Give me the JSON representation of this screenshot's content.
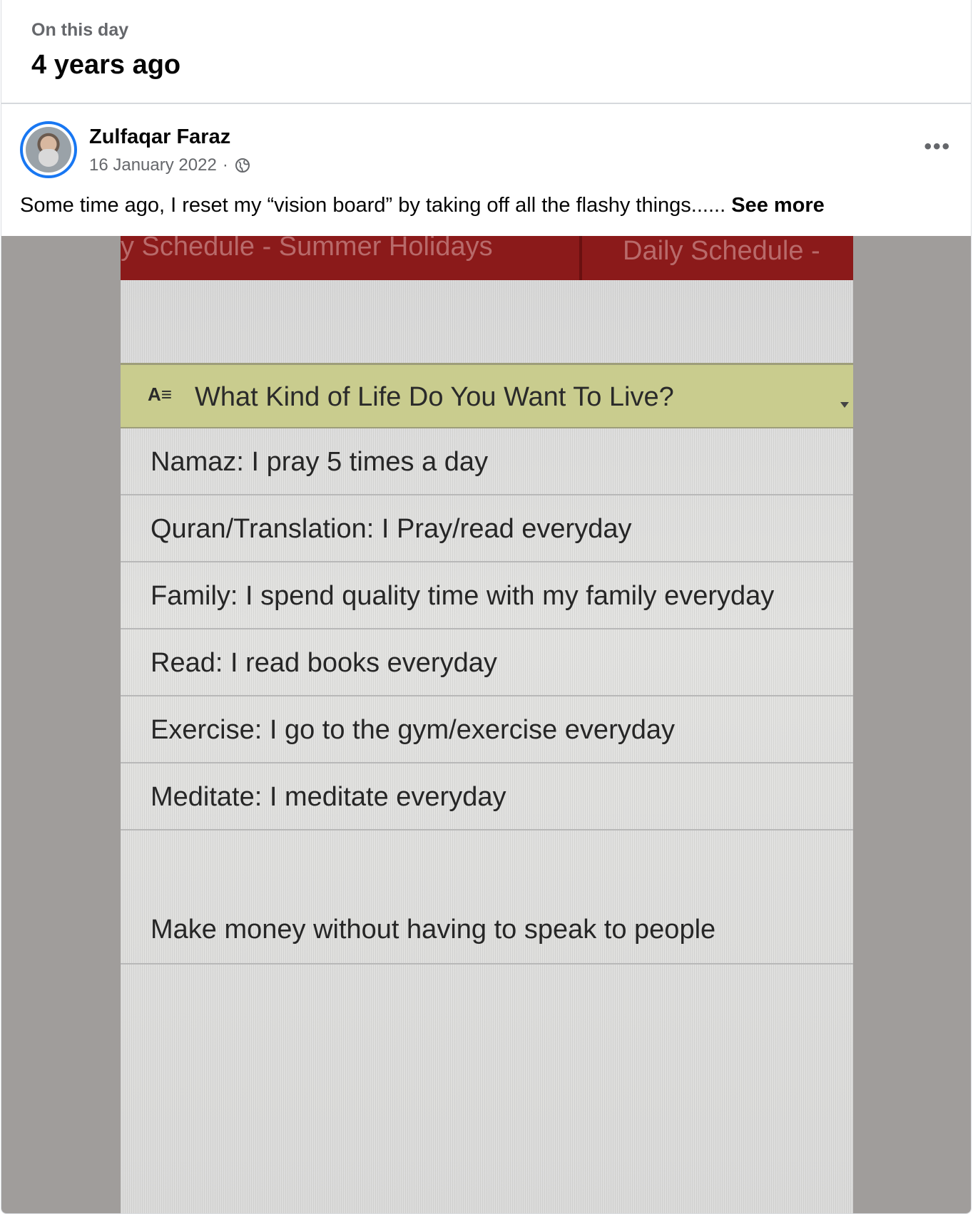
{
  "memory": {
    "kicker": "On this day",
    "title": "4 years ago"
  },
  "post": {
    "author": "Zulfaqar Faraz",
    "date": "16 January 2022",
    "separator": "·",
    "privacy_icon": "globe-icon",
    "more_icon": "more-options-icon",
    "text": "Some time ago, I reset my “vision board” by taking off all the flashy things......",
    "see_more": "See more"
  },
  "photo": {
    "tabs": [
      "y Schedule - Summer Holidays",
      "Daily Schedule -"
    ],
    "heading_icon": "A≡",
    "heading": "What Kind of Life Do You Want To Live?",
    "rows": [
      "Namaz: I pray 5 times a day",
      "Quran/Translation: I Pray/read everyday",
      "Family: I spend quality time with my family everyday",
      "Read: I read books everyday",
      "Exercise: I go to the gym/exercise everyday",
      "Meditate: I meditate everyday",
      "Make money without having to speak to people"
    ]
  },
  "colors": {
    "accent": "#1877f2",
    "secondary_text": "#65676b",
    "tab_bar": "#8b1a1a",
    "heading_row": "#c9cc8e"
  }
}
